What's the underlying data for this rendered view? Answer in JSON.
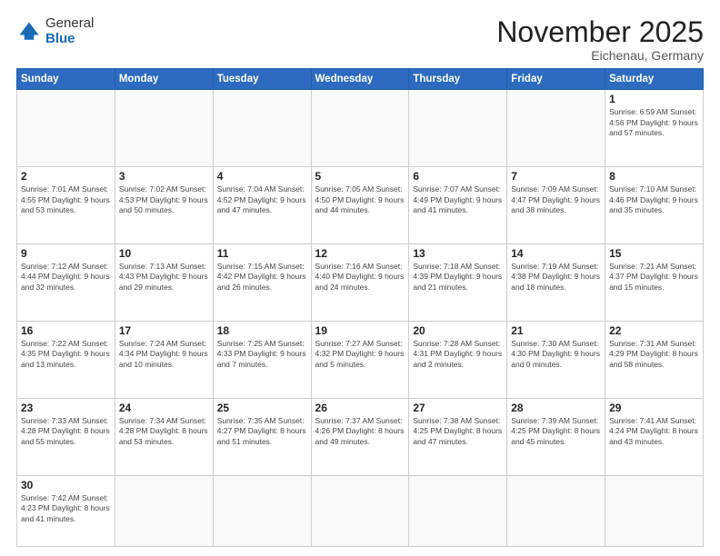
{
  "logo": {
    "general": "General",
    "blue": "Blue"
  },
  "header": {
    "month": "November 2025",
    "location": "Eichenau, Germany"
  },
  "weekdays": [
    "Sunday",
    "Monday",
    "Tuesday",
    "Wednesday",
    "Thursday",
    "Friday",
    "Saturday"
  ],
  "weeks": [
    [
      {
        "day": "",
        "info": ""
      },
      {
        "day": "",
        "info": ""
      },
      {
        "day": "",
        "info": ""
      },
      {
        "day": "",
        "info": ""
      },
      {
        "day": "",
        "info": ""
      },
      {
        "day": "",
        "info": ""
      },
      {
        "day": "1",
        "info": "Sunrise: 6:59 AM\nSunset: 4:56 PM\nDaylight: 9 hours\nand 57 minutes."
      }
    ],
    [
      {
        "day": "2",
        "info": "Sunrise: 7:01 AM\nSunset: 4:55 PM\nDaylight: 9 hours\nand 53 minutes."
      },
      {
        "day": "3",
        "info": "Sunrise: 7:02 AM\nSunset: 4:53 PM\nDaylight: 9 hours\nand 50 minutes."
      },
      {
        "day": "4",
        "info": "Sunrise: 7:04 AM\nSunset: 4:52 PM\nDaylight: 9 hours\nand 47 minutes."
      },
      {
        "day": "5",
        "info": "Sunrise: 7:05 AM\nSunset: 4:50 PM\nDaylight: 9 hours\nand 44 minutes."
      },
      {
        "day": "6",
        "info": "Sunrise: 7:07 AM\nSunset: 4:49 PM\nDaylight: 9 hours\nand 41 minutes."
      },
      {
        "day": "7",
        "info": "Sunrise: 7:09 AM\nSunset: 4:47 PM\nDaylight: 9 hours\nand 38 minutes."
      },
      {
        "day": "8",
        "info": "Sunrise: 7:10 AM\nSunset: 4:46 PM\nDaylight: 9 hours\nand 35 minutes."
      }
    ],
    [
      {
        "day": "9",
        "info": "Sunrise: 7:12 AM\nSunset: 4:44 PM\nDaylight: 9 hours\nand 32 minutes."
      },
      {
        "day": "10",
        "info": "Sunrise: 7:13 AM\nSunset: 4:43 PM\nDaylight: 9 hours\nand 29 minutes."
      },
      {
        "day": "11",
        "info": "Sunrise: 7:15 AM\nSunset: 4:42 PM\nDaylight: 9 hours\nand 26 minutes."
      },
      {
        "day": "12",
        "info": "Sunrise: 7:16 AM\nSunset: 4:40 PM\nDaylight: 9 hours\nand 24 minutes."
      },
      {
        "day": "13",
        "info": "Sunrise: 7:18 AM\nSunset: 4:39 PM\nDaylight: 9 hours\nand 21 minutes."
      },
      {
        "day": "14",
        "info": "Sunrise: 7:19 AM\nSunset: 4:38 PM\nDaylight: 9 hours\nand 18 minutes."
      },
      {
        "day": "15",
        "info": "Sunrise: 7:21 AM\nSunset: 4:37 PM\nDaylight: 9 hours\nand 15 minutes."
      }
    ],
    [
      {
        "day": "16",
        "info": "Sunrise: 7:22 AM\nSunset: 4:35 PM\nDaylight: 9 hours\nand 13 minutes."
      },
      {
        "day": "17",
        "info": "Sunrise: 7:24 AM\nSunset: 4:34 PM\nDaylight: 9 hours\nand 10 minutes."
      },
      {
        "day": "18",
        "info": "Sunrise: 7:25 AM\nSunset: 4:33 PM\nDaylight: 9 hours\nand 7 minutes."
      },
      {
        "day": "19",
        "info": "Sunrise: 7:27 AM\nSunset: 4:32 PM\nDaylight: 9 hours\nand 5 minutes."
      },
      {
        "day": "20",
        "info": "Sunrise: 7:28 AM\nSunset: 4:31 PM\nDaylight: 9 hours\nand 2 minutes."
      },
      {
        "day": "21",
        "info": "Sunrise: 7:30 AM\nSunset: 4:30 PM\nDaylight: 9 hours\nand 0 minutes."
      },
      {
        "day": "22",
        "info": "Sunrise: 7:31 AM\nSunset: 4:29 PM\nDaylight: 8 hours\nand 58 minutes."
      }
    ],
    [
      {
        "day": "23",
        "info": "Sunrise: 7:33 AM\nSunset: 4:28 PM\nDaylight: 8 hours\nand 55 minutes."
      },
      {
        "day": "24",
        "info": "Sunrise: 7:34 AM\nSunset: 4:28 PM\nDaylight: 8 hours\nand 53 minutes."
      },
      {
        "day": "25",
        "info": "Sunrise: 7:35 AM\nSunset: 4:27 PM\nDaylight: 8 hours\nand 51 minutes."
      },
      {
        "day": "26",
        "info": "Sunrise: 7:37 AM\nSunset: 4:26 PM\nDaylight: 8 hours\nand 49 minutes."
      },
      {
        "day": "27",
        "info": "Sunrise: 7:38 AM\nSunset: 4:25 PM\nDaylight: 8 hours\nand 47 minutes."
      },
      {
        "day": "28",
        "info": "Sunrise: 7:39 AM\nSunset: 4:25 PM\nDaylight: 8 hours\nand 45 minutes."
      },
      {
        "day": "29",
        "info": "Sunrise: 7:41 AM\nSunset: 4:24 PM\nDaylight: 8 hours\nand 43 minutes."
      }
    ],
    [
      {
        "day": "30",
        "info": "Sunrise: 7:42 AM\nSunset: 4:23 PM\nDaylight: 8 hours\nand 41 minutes."
      },
      {
        "day": "",
        "info": ""
      },
      {
        "day": "",
        "info": ""
      },
      {
        "day": "",
        "info": ""
      },
      {
        "day": "",
        "info": ""
      },
      {
        "day": "",
        "info": ""
      },
      {
        "day": "",
        "info": ""
      }
    ]
  ]
}
